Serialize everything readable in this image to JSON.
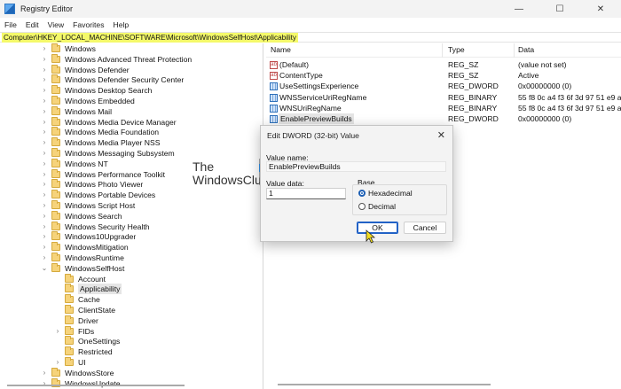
{
  "window": {
    "title": "Registry Editor",
    "minimize": "—",
    "maximize": "☐",
    "close": "✕"
  },
  "menu": [
    "File",
    "Edit",
    "View",
    "Favorites",
    "Help"
  ],
  "address": "Computer\\HKEY_LOCAL_MACHINE\\SOFTWARE\\Microsoft\\WindowsSelfHost\\Applicability",
  "tree": [
    {
      "label": "Windows",
      "expanded": false
    },
    {
      "label": "Windows Advanced Threat Protection",
      "expanded": false
    },
    {
      "label": "Windows Defender",
      "expanded": false
    },
    {
      "label": "Windows Defender Security Center",
      "expanded": false
    },
    {
      "label": "Windows Desktop Search",
      "expanded": false
    },
    {
      "label": "Windows Embedded",
      "expanded": false
    },
    {
      "label": "Windows Mail",
      "expanded": false
    },
    {
      "label": "Windows Media Device Manager",
      "expanded": false
    },
    {
      "label": "Windows Media Foundation",
      "expanded": false
    },
    {
      "label": "Windows Media Player NSS",
      "expanded": false
    },
    {
      "label": "Windows Messaging Subsystem",
      "expanded": false
    },
    {
      "label": "Windows NT",
      "expanded": false
    },
    {
      "label": "Windows Performance Toolkit",
      "expanded": false
    },
    {
      "label": "Windows Photo Viewer",
      "expanded": false
    },
    {
      "label": "Windows Portable Devices",
      "expanded": false
    },
    {
      "label": "Windows Script Host",
      "expanded": false
    },
    {
      "label": "Windows Search",
      "expanded": false
    },
    {
      "label": "Windows Security Health",
      "expanded": false
    },
    {
      "label": "Windows10Upgrader",
      "expanded": false
    },
    {
      "label": "WindowsMitigation",
      "expanded": false
    },
    {
      "label": "WindowsRuntime",
      "expanded": false
    },
    {
      "label": "WindowsSelfHost",
      "expanded": true
    },
    {
      "label": "Account",
      "expanded": false
    },
    {
      "label": "Applicability",
      "expanded": false,
      "selected": true
    },
    {
      "label": "Cache",
      "expanded": false
    },
    {
      "label": "ClientState",
      "expanded": false
    },
    {
      "label": "Driver",
      "expanded": false
    },
    {
      "label": "FIDs",
      "expanded": false
    },
    {
      "label": "OneSettings",
      "expanded": false
    },
    {
      "label": "Restricted",
      "expanded": false
    },
    {
      "label": "UI",
      "expanded": false
    },
    {
      "label": "WindowsStore",
      "expanded": false
    },
    {
      "label": "WindowsUpdate",
      "expanded": false
    }
  ],
  "columns": {
    "name": "Name",
    "type": "Type",
    "data": "Data"
  },
  "values": [
    {
      "name": "(Default)",
      "type": "REG_SZ",
      "data": "(value not set)",
      "icon": "string-value-icon"
    },
    {
      "name": "ContentType",
      "type": "REG_SZ",
      "data": "Active",
      "icon": "string-value-icon"
    },
    {
      "name": "UseSettingsExperience",
      "type": "REG_DWORD",
      "data": "0x00000000 (0)",
      "icon": "binary-value-icon"
    },
    {
      "name": "WNSServiceUriRegName",
      "type": "REG_BINARY",
      "data": "55 f8 0c a4 f3 6f 3d 97 51 e9 a4 14",
      "icon": "binary-value-icon"
    },
    {
      "name": "WNSUriRegName",
      "type": "REG_BINARY",
      "data": "55 f8 0c a4 f3 6f 3d 97 51 e9 a4 14",
      "icon": "binary-value-icon"
    },
    {
      "name": "EnablePreviewBuilds",
      "type": "REG_DWORD",
      "data": "0x00000000 (0)",
      "icon": "binary-value-icon",
      "selected": true
    }
  ],
  "watermark": {
    "line1": "The",
    "line2": "WindowsClub"
  },
  "dialog": {
    "title": "Edit DWORD (32-bit) Value",
    "close": "✕",
    "value_name_label": "Value name:",
    "value_name": "EnablePreviewBuilds",
    "value_data_label": "Value data:",
    "value_data": "1",
    "base_label": "Base",
    "hex_label": "Hexadecimal",
    "dec_label": "Decimal",
    "selected_base": "Hexadecimal",
    "ok_label": "OK",
    "cancel_label": "Cancel"
  }
}
